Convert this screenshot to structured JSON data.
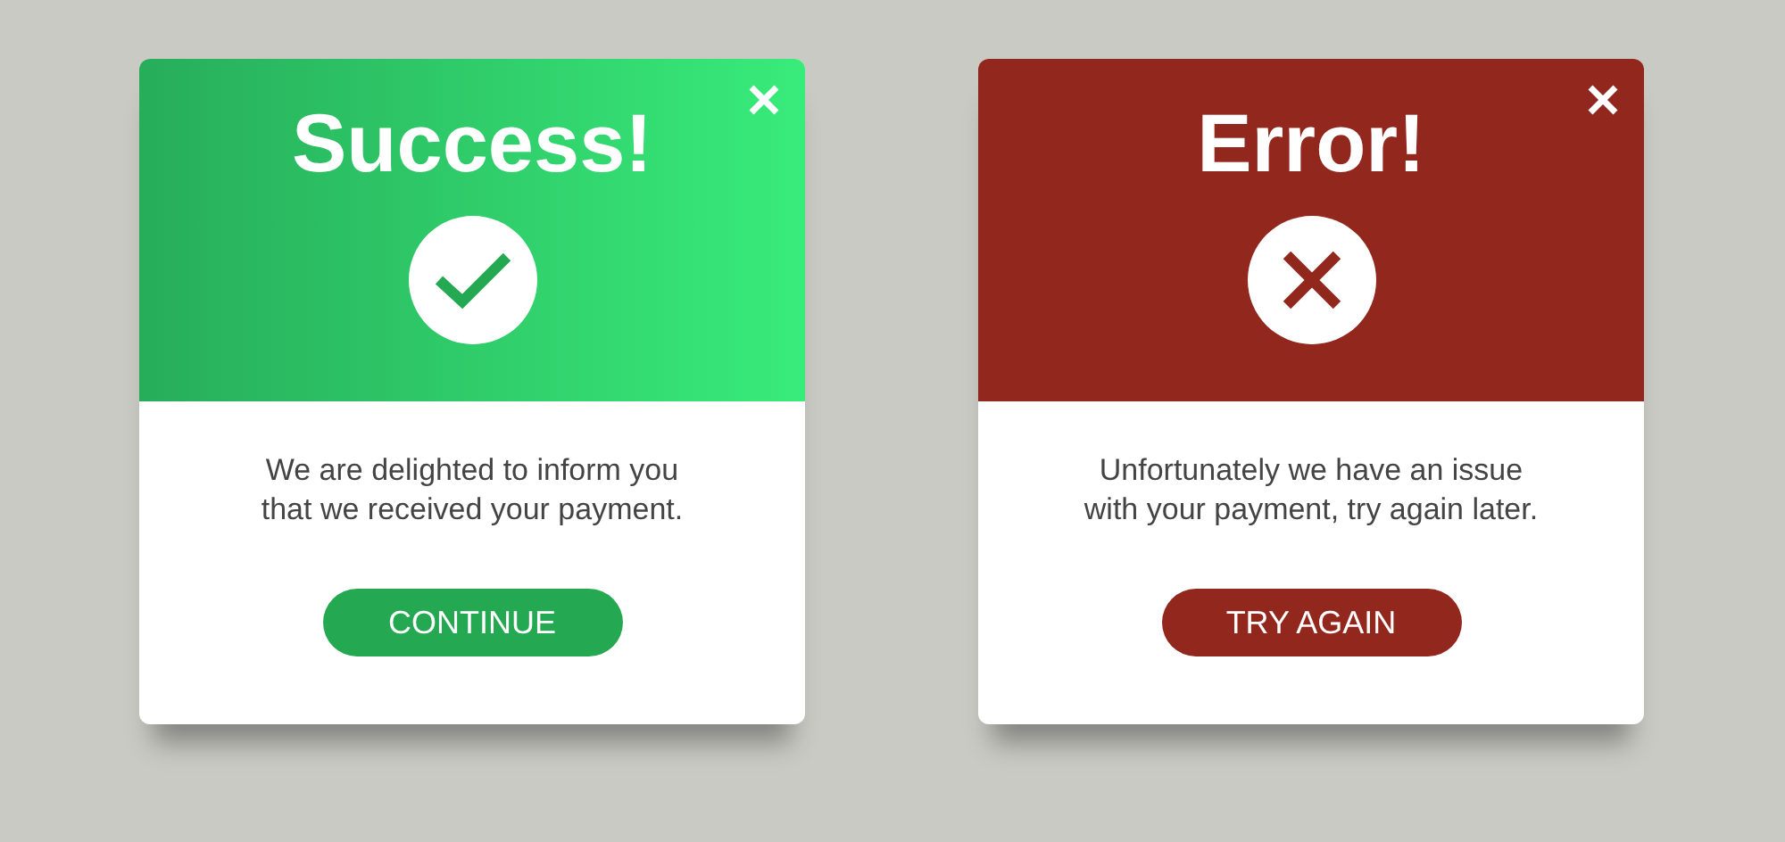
{
  "dialogs": [
    {
      "kind": "success",
      "title": "Success!",
      "message": [
        "We are delighted to inform you",
        "that we received your payment."
      ],
      "button": "CONTINUE"
    },
    {
      "kind": "error",
      "title": "Error!",
      "message": [
        "Unfortunately we have an issue",
        "with your payment, try again later."
      ],
      "button": "TRY AGAIN"
    }
  ]
}
